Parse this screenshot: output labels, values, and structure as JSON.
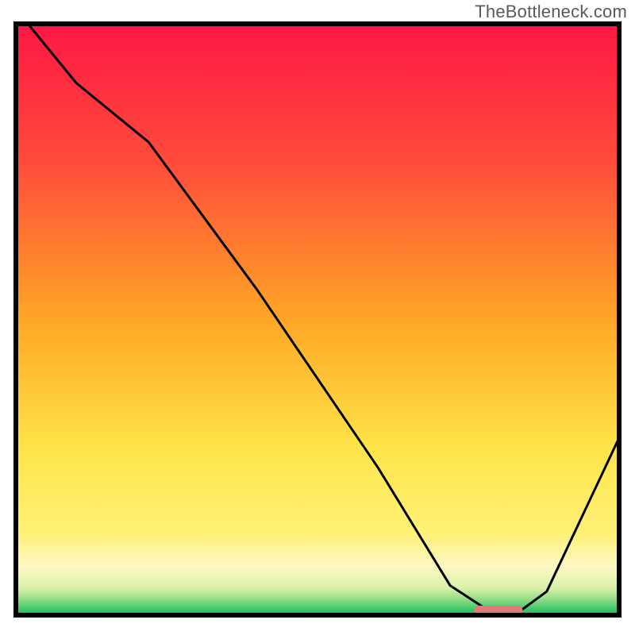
{
  "watermark": "TheBottleneck.com",
  "chart_data": {
    "type": "line",
    "title": "",
    "xlabel": "",
    "ylabel": "",
    "xlim": [
      0,
      100
    ],
    "ylim": [
      0,
      100
    ],
    "x": [
      2,
      10,
      22,
      40,
      60,
      72,
      78,
      82,
      84,
      88,
      100
    ],
    "values": [
      100,
      90,
      80,
      55,
      25,
      5,
      1,
      1,
      1,
      4,
      30
    ],
    "marker": {
      "x_start": 76,
      "x_end": 84,
      "y": 0.8
    },
    "gradient_stops": [
      {
        "offset": 0,
        "color": "#ff1744"
      },
      {
        "offset": 24,
        "color": "#ff4d3a"
      },
      {
        "offset": 50,
        "color": "#ffa726"
      },
      {
        "offset": 72,
        "color": "#ffe54a"
      },
      {
        "offset": 86,
        "color": "#fff176"
      },
      {
        "offset": 92,
        "color": "#fdf8c4"
      },
      {
        "offset": 95.5,
        "color": "#d8f0a8"
      },
      {
        "offset": 97,
        "color": "#9fe08a"
      },
      {
        "offset": 99,
        "color": "#3fc76a"
      },
      {
        "offset": 100,
        "color": "#18b85e"
      }
    ],
    "frame_color": "#000000",
    "line_color": "#000000",
    "marker_color": "#e27a7a"
  }
}
